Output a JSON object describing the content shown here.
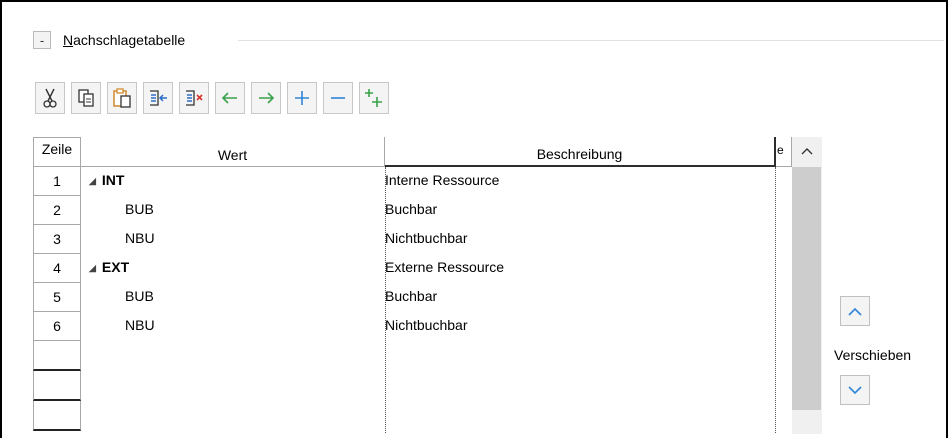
{
  "group": {
    "collapse_label": "-",
    "title_prefix": "N",
    "title_rest": "achschlagetabelle"
  },
  "toolbar": {
    "buttons": [
      {
        "name": "cut-icon",
        "color": "#333333"
      },
      {
        "name": "copy-icon",
        "color": "#333333"
      },
      {
        "name": "paste-icon",
        "color": "#d08a2c"
      },
      {
        "name": "insert-row-icon",
        "color": "#2f6fc9"
      },
      {
        "name": "delete-row-icon",
        "color": "#d9362b"
      },
      {
        "name": "arrow-left-icon",
        "color": "#3aa24a"
      },
      {
        "name": "arrow-right-icon",
        "color": "#3aa24a"
      },
      {
        "name": "plus-icon",
        "color": "#2f86d6"
      },
      {
        "name": "minus-icon",
        "color": "#2f86d6"
      },
      {
        "name": "add-child-icon",
        "color": "#3aa24a"
      }
    ]
  },
  "table": {
    "headers": {
      "zeile": "Zeile",
      "wert": "Wert",
      "beschreibung": "Beschreibung",
      "extra": "e"
    },
    "rows": [
      {
        "num": "1",
        "wert": "INT",
        "beschreibung": "Interne Ressource",
        "level": 0
      },
      {
        "num": "2",
        "wert": "BUB",
        "beschreibung": "Buchbar",
        "level": 1
      },
      {
        "num": "3",
        "wert": "NBU",
        "beschreibung": "Nichtbuchbar",
        "level": 1
      },
      {
        "num": "4",
        "wert": "EXT",
        "beschreibung": "Externe Ressource",
        "level": 0
      },
      {
        "num": "5",
        "wert": "BUB",
        "beschreibung": "Buchbar",
        "level": 1
      },
      {
        "num": "6",
        "wert": "NBU",
        "beschreibung": "Nichtbuchbar",
        "level": 1
      }
    ]
  },
  "side": {
    "move_label": "Verschieben"
  }
}
